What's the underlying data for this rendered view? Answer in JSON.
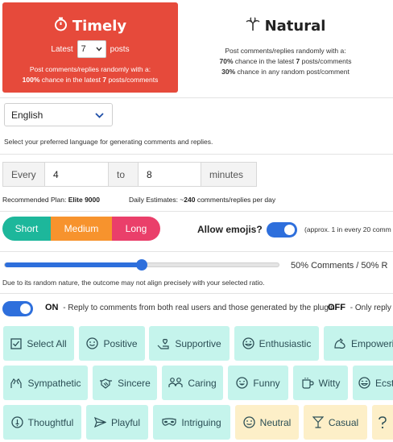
{
  "modes": {
    "timely": {
      "title": "Timely",
      "latest_prefix": "Latest",
      "latest_value": "7",
      "latest_suffix": "posts",
      "desc_line1": "Post comments/replies randomly with a:",
      "desc_pct": "100%",
      "desc_mid": " chance in the latest ",
      "desc_num": "7",
      "desc_end": " posts/comments"
    },
    "natural": {
      "title": "Natural",
      "desc_line1": "Post comments/replies randomly with a:",
      "l2_pct": "70%",
      "l2_mid": " chance in the latest ",
      "l2_num": "7",
      "l2_end": " posts/comments",
      "l3_pct": "30%",
      "l3_end": " chance in any random post/comment"
    }
  },
  "language": {
    "selected": "English",
    "help": "Select your preferred language for generating comments and replies."
  },
  "frequency": {
    "every_label": "Every",
    "min_value": "4",
    "to_label": "to",
    "max_value": "8",
    "unit_label": "minutes"
  },
  "plan": {
    "prefix": "Recommended Plan:",
    "name": "Elite 9000",
    "est_prefix": "Daily Estimates: ~",
    "est_value": "240",
    "est_suffix": " comments/replies per day"
  },
  "length": {
    "short": "Short",
    "medium": "Medium",
    "long": "Long",
    "colors": {
      "short": "#1db79b",
      "medium": "#f7932d",
      "long": "#ea3f6a"
    }
  },
  "emojis": {
    "label": "Allow emojis?",
    "enabled": true,
    "note": "(approx. 1 in every 20 comm"
  },
  "ratio": {
    "comments_fraction": 0.5,
    "label": "50% Comments / 50% R",
    "note": "Due to its random nature, the outcome may not align precisely with your selected ratio."
  },
  "reply_mode": {
    "enabled": true,
    "on_label": "ON",
    "on_text": "- Reply to comments from both real users and those generated by the plugin.",
    "off_label": "OFF",
    "off_text": "- Only reply to"
  },
  "tones": [
    {
      "label": "Select All",
      "icon": "checkbox-icon"
    },
    {
      "label": "Positive",
      "icon": "smile-icon"
    },
    {
      "label": "Supportive",
      "icon": "hand-heart-icon"
    },
    {
      "label": "Enthusiastic",
      "icon": "grin-icon"
    },
    {
      "label": "Empowering",
      "icon": "flex-icon"
    },
    {
      "label": "Sympathetic",
      "icon": "hands-icon"
    },
    {
      "label": "Sincere",
      "icon": "handshake-icon"
    },
    {
      "label": "Caring",
      "icon": "people-icon"
    },
    {
      "label": "Funny",
      "icon": "laugh-icon"
    },
    {
      "label": "Witty",
      "icon": "mug-icon"
    },
    {
      "label": "Ecst",
      "icon": "ecstatic-icon"
    },
    {
      "label": "Thoughtful",
      "icon": "lightbulb-icon"
    },
    {
      "label": "Playful",
      "icon": "paper-plane-icon"
    },
    {
      "label": "Intriguing",
      "icon": "mask-icon"
    },
    {
      "label": "Neutral",
      "icon": "neutral-face-icon"
    },
    {
      "label": "Casual",
      "icon": "cocktail-icon"
    },
    {
      "label": "",
      "icon": "question-icon"
    }
  ]
}
